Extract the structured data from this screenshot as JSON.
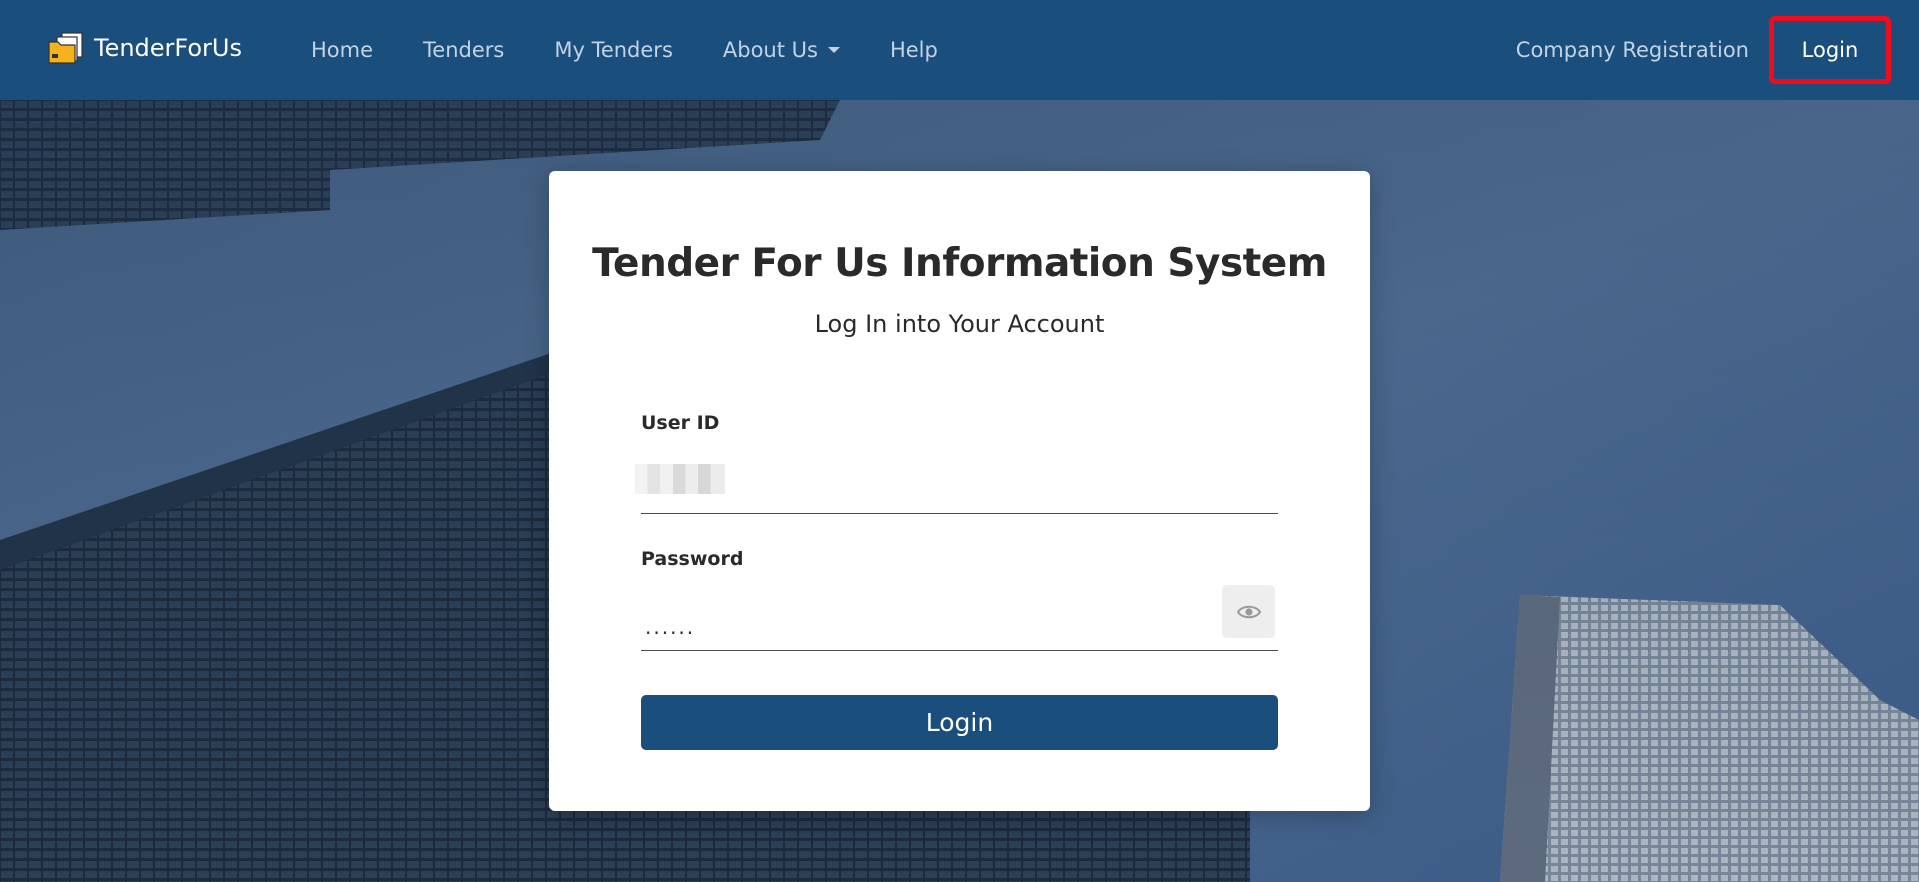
{
  "brand": {
    "name": "TenderForUs"
  },
  "nav": {
    "links": [
      {
        "label": "Home"
      },
      {
        "label": "Tenders"
      },
      {
        "label": "My Tenders"
      },
      {
        "label": "About Us"
      },
      {
        "label": "Help"
      }
    ],
    "company_registration": "Company Registration",
    "login": "Login"
  },
  "card": {
    "title": "Tender For Us Information System",
    "subtitle": "Log In into Your Account",
    "user_label": "User ID",
    "password_label": "Password",
    "password_value": "......",
    "submit_label": "Login"
  },
  "colors": {
    "navbar": "#1a4e7d",
    "highlight": "#f00c1c",
    "button": "#1a4e7d"
  },
  "icons": {
    "brand": "folder-icon",
    "toggle_password": "eye-icon",
    "dropdown": "chevron-down-icon"
  }
}
